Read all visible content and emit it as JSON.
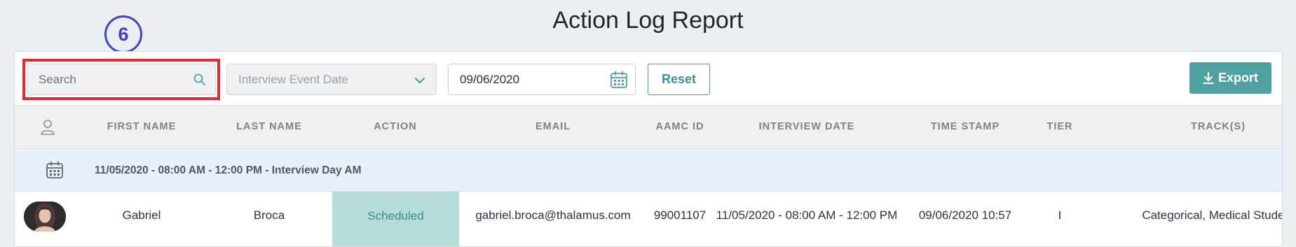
{
  "page": {
    "title": "Action Log Report",
    "step_badge": "6"
  },
  "toolbar": {
    "search_placeholder": "Search",
    "date_filter_label": "Interview Event Date",
    "date_value": "09/06/2020",
    "reset_label": "Reset",
    "export_label": "Export"
  },
  "table": {
    "columns": [
      "FIRST NAME",
      "LAST NAME",
      "ACTION",
      "EMAIL",
      "AAMC ID",
      "INTERVIEW DATE",
      "TIME STAMP",
      "TIER",
      "TRACK(S)"
    ],
    "groups": [
      {
        "label": "11/05/2020 - 08:00 AM - 12:00 PM - Interview Day AM",
        "rows": [
          {
            "first_name": "Gabriel",
            "last_name": "Broca",
            "action": "Scheduled",
            "email": "gabriel.broca@thalamus.com",
            "aamc_id": "99001107",
            "interview_date": "11/05/2020 - 08:00 AM - 12:00 PM",
            "time_stamp": "09/06/2020 10:57",
            "tier": "I",
            "tracks": "Categorical, Medical Student"
          }
        ]
      }
    ]
  },
  "colors": {
    "accent": "#4ea0a1",
    "highlight": "#e8262e",
    "badge": "#3d44c8",
    "group_row_bg": "#e8f0fb",
    "action_scheduled_bg": "#b4dcd9"
  },
  "icons": [
    "search-icon",
    "chevron-down-icon",
    "calendar-icon",
    "download-icon",
    "person-icon",
    "avatar"
  ]
}
